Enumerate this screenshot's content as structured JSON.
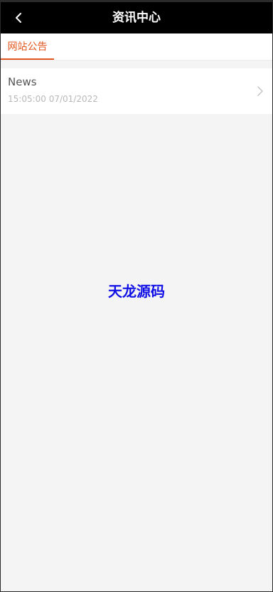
{
  "header": {
    "title": "资讯中心",
    "back_icon": "chevron-left-icon"
  },
  "tabs": [
    {
      "label": "网站公告",
      "active": true
    }
  ],
  "list": [
    {
      "title": "News",
      "time": "15:05:00 07/01/2022",
      "icon": "chevron-right-icon"
    }
  ],
  "watermark": "天龙源码",
  "colors": {
    "header_bg": "#000000",
    "accent": "#e2561f",
    "watermark": "#1010e6"
  }
}
